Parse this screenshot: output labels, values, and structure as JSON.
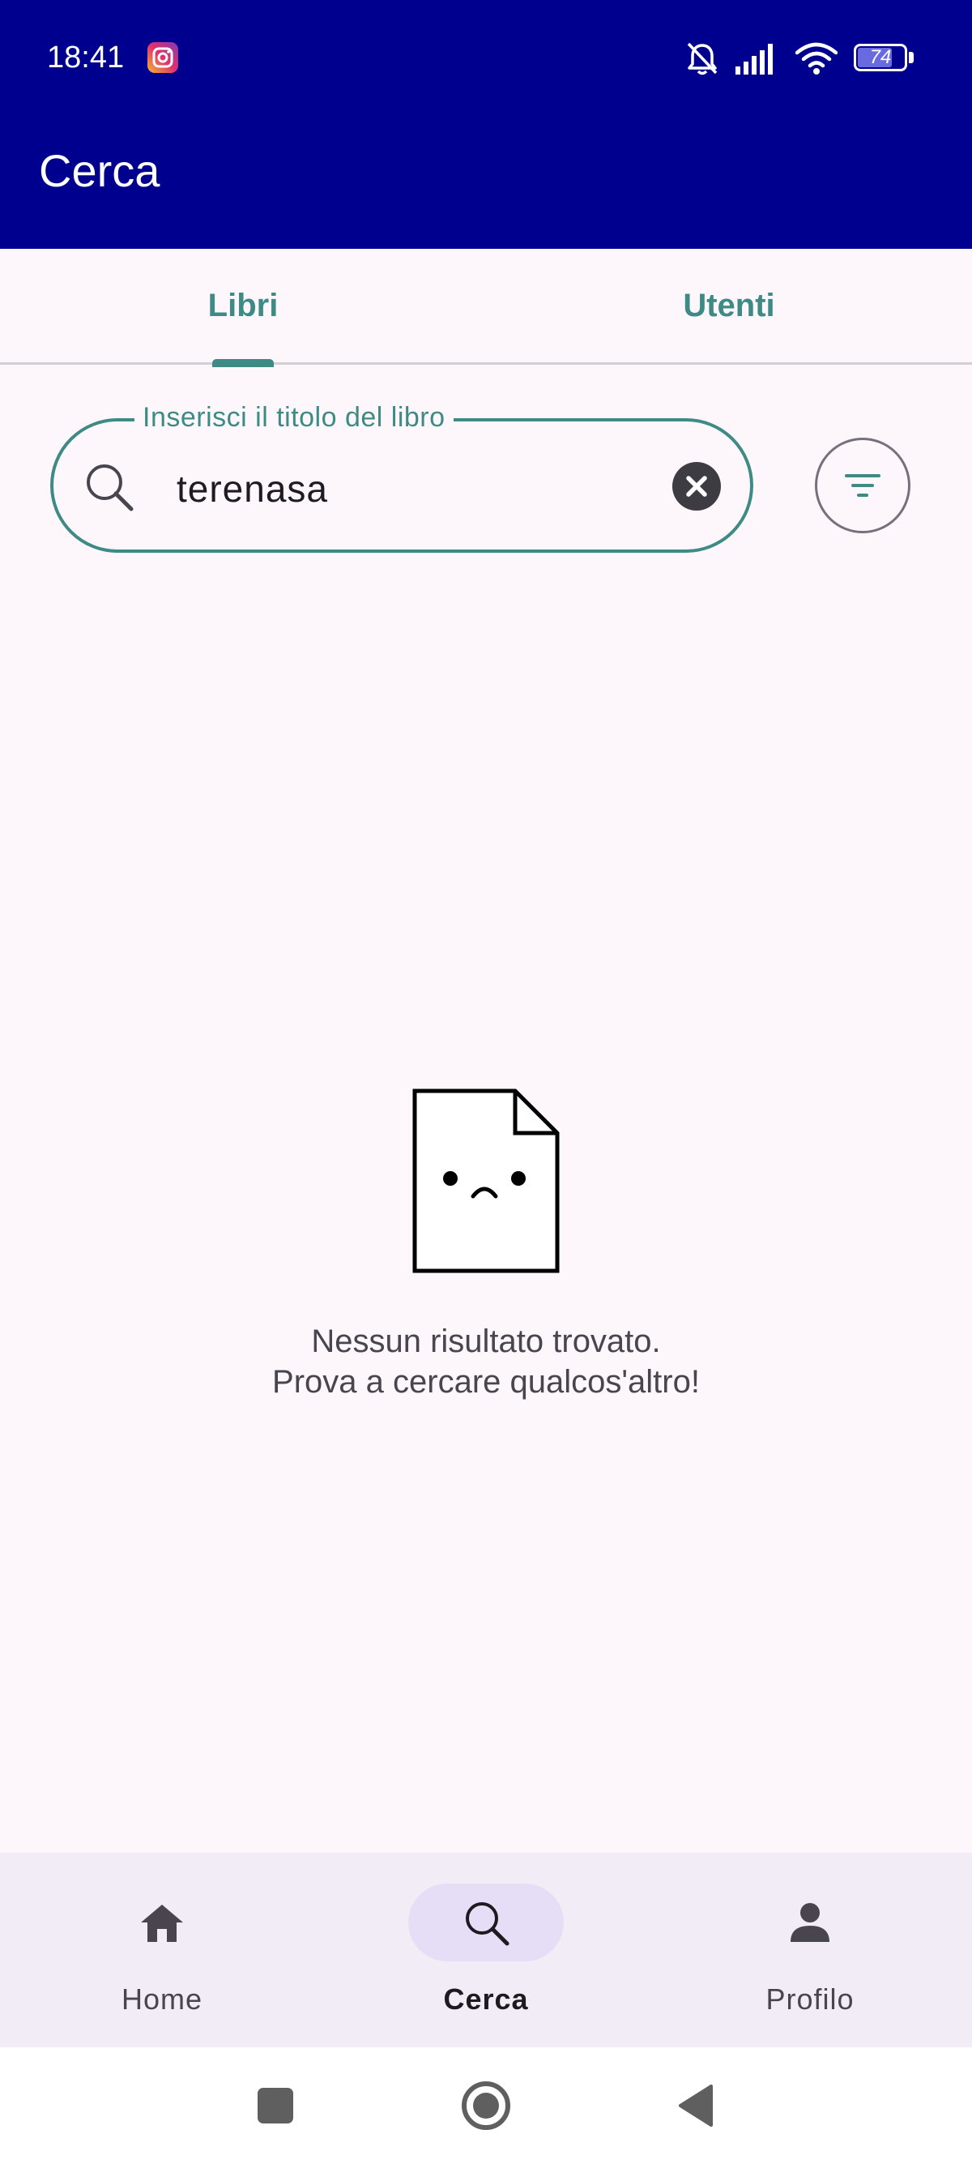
{
  "status_bar": {
    "time": "18:41",
    "battery": "74"
  },
  "app_bar": {
    "title": "Cerca"
  },
  "tabs": [
    {
      "label": "Libri",
      "selected": true
    },
    {
      "label": "Utenti",
      "selected": false
    }
  ],
  "search": {
    "label": "Inserisci il titolo del libro",
    "value": "terenasa"
  },
  "empty_state": {
    "line1": "Nessun risultato trovato.",
    "line2": "Prova a cercare qualcos'altro!"
  },
  "bottom_nav": {
    "items": [
      {
        "label": "Home",
        "icon": "home-icon",
        "active": false
      },
      {
        "label": "Cerca",
        "icon": "search-icon",
        "active": true
      },
      {
        "label": "Profilo",
        "icon": "person-icon",
        "active": false
      }
    ]
  },
  "colors": {
    "app_bar": "#00008f",
    "accent": "#3e8a85",
    "background": "#fdf7fc",
    "nav_background": "#f2ecf6",
    "nav_active_pill": "#e6def6"
  }
}
